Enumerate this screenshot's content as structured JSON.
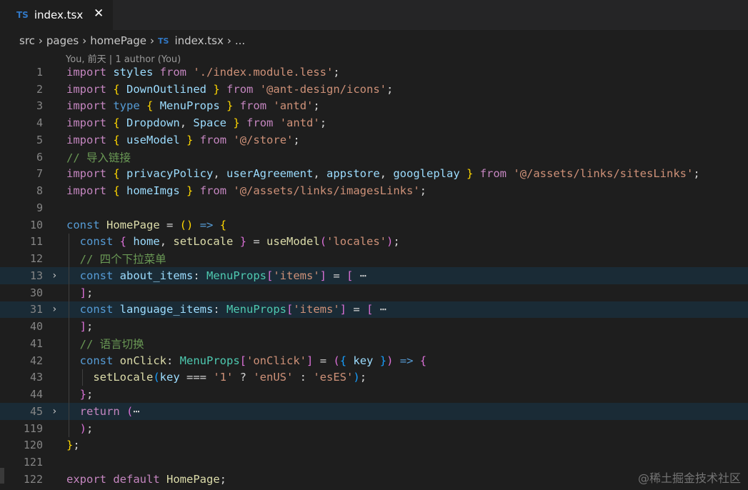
{
  "tab": {
    "icon": "TS",
    "label": "index.tsx",
    "close": "✕"
  },
  "breadcrumb": {
    "items": [
      "src",
      "pages",
      "homePage"
    ],
    "file_icon": "TS",
    "file": "index.tsx",
    "more": "..."
  },
  "blame": "You, 前天 | 1 author (You)",
  "watermark": "@稀土掘金技术社区",
  "colors": {
    "keyword": "#c586c0",
    "keyword_blue": "#569cd6",
    "variable": "#9cdcfe",
    "type": "#4ec9b0",
    "function": "#dcdcaa",
    "string": "#ce9178",
    "comment": "#6a9955",
    "punct": "#d4d4d4",
    "bracket_gold": "#ffd700",
    "bracket_pink": "#da70d6",
    "bracket_blue": "#179fff"
  },
  "lines": [
    {
      "n": "1",
      "fold": "",
      "hl": false,
      "tokens": [
        [
          "import",
          "keyword"
        ],
        [
          " styles ",
          "variable"
        ],
        [
          "from",
          "keyword"
        ],
        [
          " ",
          "punct"
        ],
        [
          "'./index.module.less'",
          "string"
        ],
        [
          ";",
          "punct"
        ]
      ]
    },
    {
      "n": "2",
      "fold": "",
      "hl": false,
      "tokens": [
        [
          "import",
          "keyword"
        ],
        [
          " ",
          "punct"
        ],
        [
          "{",
          "bracket_gold"
        ],
        [
          " DownOutlined ",
          "variable"
        ],
        [
          "}",
          "bracket_gold"
        ],
        [
          " ",
          "punct"
        ],
        [
          "from",
          "keyword"
        ],
        [
          " ",
          "punct"
        ],
        [
          "'@ant-design/icons'",
          "string"
        ],
        [
          ";",
          "punct"
        ]
      ]
    },
    {
      "n": "3",
      "fold": "",
      "hl": false,
      "tokens": [
        [
          "import",
          "keyword"
        ],
        [
          " ",
          "punct"
        ],
        [
          "type",
          "keyword_blue"
        ],
        [
          " ",
          "punct"
        ],
        [
          "{",
          "bracket_gold"
        ],
        [
          " MenuProps ",
          "variable"
        ],
        [
          "}",
          "bracket_gold"
        ],
        [
          " ",
          "punct"
        ],
        [
          "from",
          "keyword"
        ],
        [
          " ",
          "punct"
        ],
        [
          "'antd'",
          "string"
        ],
        [
          ";",
          "punct"
        ]
      ]
    },
    {
      "n": "4",
      "fold": "",
      "hl": false,
      "tokens": [
        [
          "import",
          "keyword"
        ],
        [
          " ",
          "punct"
        ],
        [
          "{",
          "bracket_gold"
        ],
        [
          " Dropdown",
          "variable"
        ],
        [
          ", ",
          "punct"
        ],
        [
          "Space ",
          "variable"
        ],
        [
          "}",
          "bracket_gold"
        ],
        [
          " ",
          "punct"
        ],
        [
          "from",
          "keyword"
        ],
        [
          " ",
          "punct"
        ],
        [
          "'antd'",
          "string"
        ],
        [
          ";",
          "punct"
        ]
      ]
    },
    {
      "n": "5",
      "fold": "",
      "hl": false,
      "tokens": [
        [
          "import",
          "keyword"
        ],
        [
          " ",
          "punct"
        ],
        [
          "{",
          "bracket_gold"
        ],
        [
          " useModel ",
          "variable"
        ],
        [
          "}",
          "bracket_gold"
        ],
        [
          " ",
          "punct"
        ],
        [
          "from",
          "keyword"
        ],
        [
          " ",
          "punct"
        ],
        [
          "'@/store'",
          "string"
        ],
        [
          ";",
          "punct"
        ]
      ]
    },
    {
      "n": "6",
      "fold": "",
      "hl": false,
      "tokens": [
        [
          "// 导入链接",
          "comment"
        ]
      ]
    },
    {
      "n": "7",
      "fold": "",
      "hl": false,
      "tokens": [
        [
          "import",
          "keyword"
        ],
        [
          " ",
          "punct"
        ],
        [
          "{",
          "bracket_gold"
        ],
        [
          " privacyPolicy",
          "variable"
        ],
        [
          ", ",
          "punct"
        ],
        [
          "userAgreement",
          "variable"
        ],
        [
          ", ",
          "punct"
        ],
        [
          "appstore",
          "variable"
        ],
        [
          ", ",
          "punct"
        ],
        [
          "googleplay ",
          "variable"
        ],
        [
          "}",
          "bracket_gold"
        ],
        [
          " ",
          "punct"
        ],
        [
          "from",
          "keyword"
        ],
        [
          " ",
          "punct"
        ],
        [
          "'@/assets/links/sitesLinks'",
          "string"
        ],
        [
          ";",
          "punct"
        ]
      ]
    },
    {
      "n": "8",
      "fold": "",
      "hl": false,
      "tokens": [
        [
          "import",
          "keyword"
        ],
        [
          " ",
          "punct"
        ],
        [
          "{",
          "bracket_gold"
        ],
        [
          " homeImgs ",
          "variable"
        ],
        [
          "}",
          "bracket_gold"
        ],
        [
          " ",
          "punct"
        ],
        [
          "from",
          "keyword"
        ],
        [
          " ",
          "punct"
        ],
        [
          "'@/assets/links/imagesLinks'",
          "string"
        ],
        [
          ";",
          "punct"
        ]
      ]
    },
    {
      "n": "9",
      "fold": "",
      "hl": false,
      "tokens": []
    },
    {
      "n": "10",
      "fold": "",
      "hl": false,
      "tokens": [
        [
          "const",
          "keyword_blue"
        ],
        [
          " ",
          "punct"
        ],
        [
          "HomePage",
          "function"
        ],
        [
          " = ",
          "punct"
        ],
        [
          "()",
          "bracket_gold"
        ],
        [
          " ",
          "punct"
        ],
        [
          "=>",
          "keyword_blue"
        ],
        [
          " ",
          "punct"
        ],
        [
          "{",
          "bracket_gold"
        ]
      ]
    },
    {
      "n": "11",
      "fold": "",
      "hl": false,
      "tokens": [
        [
          "  const",
          "keyword_blue"
        ],
        [
          " ",
          "punct"
        ],
        [
          "{",
          "bracket_pink"
        ],
        [
          " home",
          "variable"
        ],
        [
          ", ",
          "punct"
        ],
        [
          "setLocale ",
          "function"
        ],
        [
          "}",
          "bracket_pink"
        ],
        [
          " = ",
          "punct"
        ],
        [
          "useModel",
          "function"
        ],
        [
          "(",
          "bracket_pink"
        ],
        [
          "'locales'",
          "string"
        ],
        [
          ")",
          "bracket_pink"
        ],
        [
          ";",
          "punct"
        ]
      ]
    },
    {
      "n": "12",
      "fold": "",
      "hl": false,
      "tokens": [
        [
          "  // 四个下拉菜单",
          "comment"
        ]
      ]
    },
    {
      "n": "13",
      "fold": "›",
      "hl": true,
      "tokens": [
        [
          "  const",
          "keyword_blue"
        ],
        [
          " ",
          "punct"
        ],
        [
          "about_items",
          "variable"
        ],
        [
          ": ",
          "punct"
        ],
        [
          "MenuProps",
          "type"
        ],
        [
          "[",
          "bracket_pink"
        ],
        [
          "'items'",
          "string"
        ],
        [
          "]",
          "bracket_pink"
        ],
        [
          " = ",
          "punct"
        ],
        [
          "[",
          "bracket_pink"
        ],
        [
          " ⋯",
          "punct"
        ]
      ]
    },
    {
      "n": "30",
      "fold": "",
      "hl": false,
      "tokens": [
        [
          "  ",
          "punct"
        ],
        [
          "]",
          "bracket_pink"
        ],
        [
          ";",
          "punct"
        ]
      ]
    },
    {
      "n": "31",
      "fold": "›",
      "hl": true,
      "tokens": [
        [
          "  const",
          "keyword_blue"
        ],
        [
          " ",
          "punct"
        ],
        [
          "language_items",
          "variable"
        ],
        [
          ": ",
          "punct"
        ],
        [
          "MenuProps",
          "type"
        ],
        [
          "[",
          "bracket_pink"
        ],
        [
          "'items'",
          "string"
        ],
        [
          "]",
          "bracket_pink"
        ],
        [
          " = ",
          "punct"
        ],
        [
          "[",
          "bracket_pink"
        ],
        [
          " ⋯",
          "punct"
        ]
      ]
    },
    {
      "n": "40",
      "fold": "",
      "hl": false,
      "tokens": [
        [
          "  ",
          "punct"
        ],
        [
          "]",
          "bracket_pink"
        ],
        [
          ";",
          "punct"
        ]
      ]
    },
    {
      "n": "41",
      "fold": "",
      "hl": false,
      "tokens": [
        [
          "  // 语言切换",
          "comment"
        ]
      ]
    },
    {
      "n": "42",
      "fold": "",
      "hl": false,
      "tokens": [
        [
          "  const",
          "keyword_blue"
        ],
        [
          " ",
          "punct"
        ],
        [
          "onClick",
          "function"
        ],
        [
          ": ",
          "punct"
        ],
        [
          "MenuProps",
          "type"
        ],
        [
          "[",
          "bracket_pink"
        ],
        [
          "'onClick'",
          "string"
        ],
        [
          "]",
          "bracket_pink"
        ],
        [
          " = ",
          "punct"
        ],
        [
          "(",
          "bracket_pink"
        ],
        [
          "{",
          "bracket_blue"
        ],
        [
          " key ",
          "variable"
        ],
        [
          "}",
          "bracket_blue"
        ],
        [
          ")",
          "bracket_pink"
        ],
        [
          " ",
          "punct"
        ],
        [
          "=>",
          "keyword_blue"
        ],
        [
          " ",
          "punct"
        ],
        [
          "{",
          "bracket_pink"
        ]
      ]
    },
    {
      "n": "43",
      "fold": "",
      "hl": false,
      "tokens": [
        [
          "    setLocale",
          "function"
        ],
        [
          "(",
          "bracket_blue"
        ],
        [
          "key",
          "variable"
        ],
        [
          " === ",
          "punct"
        ],
        [
          "'1'",
          "string"
        ],
        [
          " ? ",
          "punct"
        ],
        [
          "'enUS'",
          "string"
        ],
        [
          " : ",
          "punct"
        ],
        [
          "'esES'",
          "string"
        ],
        [
          ")",
          "bracket_blue"
        ],
        [
          ";",
          "punct"
        ]
      ]
    },
    {
      "n": "44",
      "fold": "",
      "hl": false,
      "tokens": [
        [
          "  ",
          "punct"
        ],
        [
          "}",
          "bracket_pink"
        ],
        [
          ";",
          "punct"
        ]
      ]
    },
    {
      "n": "45",
      "fold": "›",
      "hl": true,
      "tokens": [
        [
          "  return",
          "keyword"
        ],
        [
          " ",
          "punct"
        ],
        [
          "(",
          "bracket_pink"
        ],
        [
          "⋯",
          "punct"
        ]
      ]
    },
    {
      "n": "119",
      "fold": "",
      "hl": false,
      "tokens": [
        [
          "  ",
          "punct"
        ],
        [
          ")",
          "bracket_pink"
        ],
        [
          ";",
          "punct"
        ]
      ]
    },
    {
      "n": "120",
      "fold": "",
      "hl": false,
      "tokens": [
        [
          "}",
          "bracket_gold"
        ],
        [
          ";",
          "punct"
        ]
      ]
    },
    {
      "n": "121",
      "fold": "",
      "hl": false,
      "tokens": []
    },
    {
      "n": "122",
      "fold": "",
      "hl": false,
      "tokens": [
        [
          "export",
          "keyword"
        ],
        [
          " ",
          "punct"
        ],
        [
          "default",
          "keyword"
        ],
        [
          " HomePage",
          "function"
        ],
        [
          ";",
          "punct"
        ]
      ]
    }
  ]
}
